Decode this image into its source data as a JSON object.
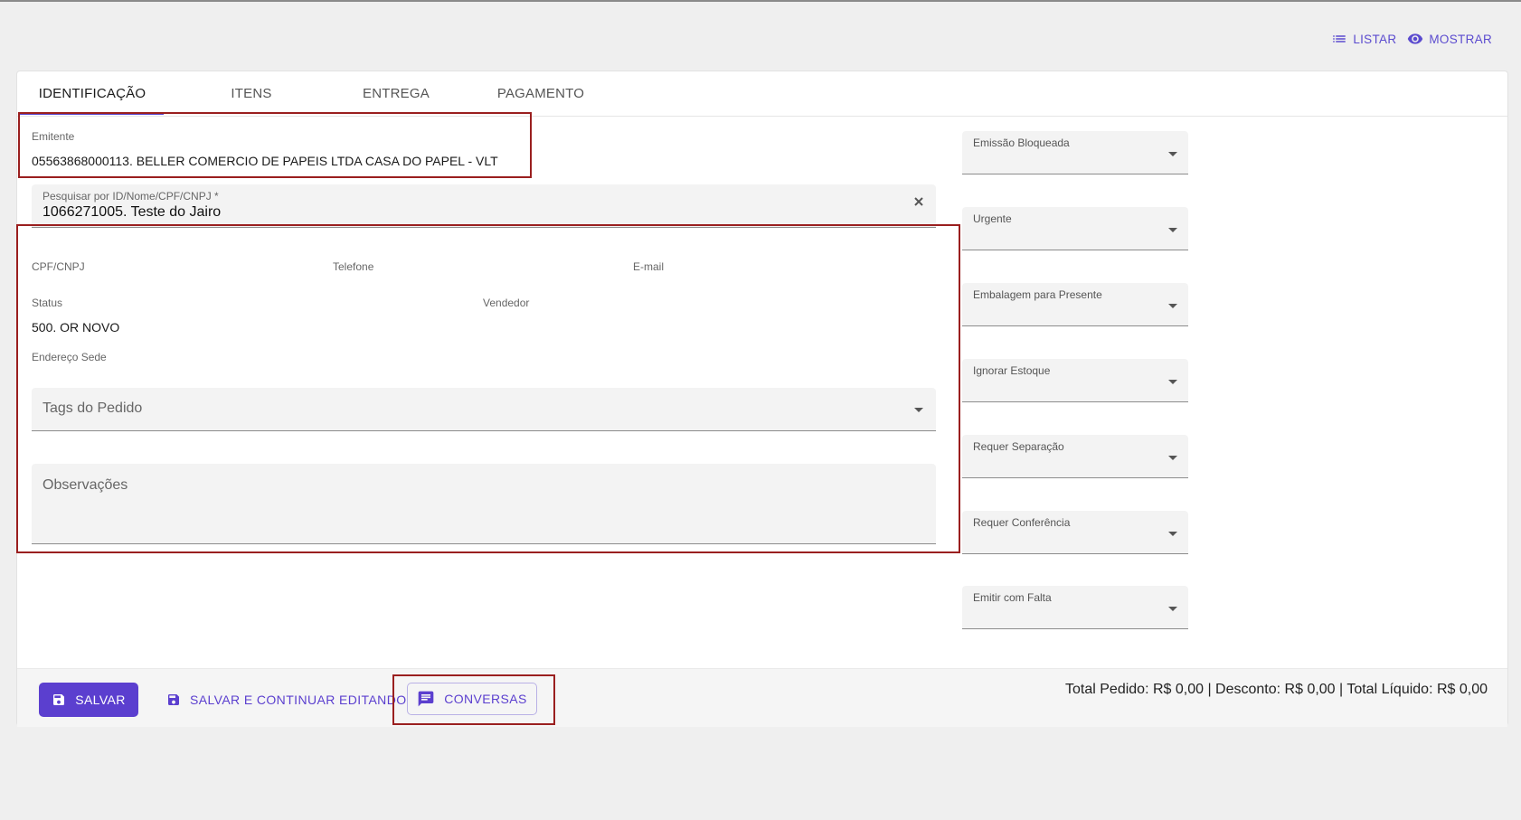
{
  "top_actions": {
    "list_label": "LISTAR",
    "show_label": "MOSTRAR"
  },
  "tabs": [
    {
      "label": "IDENTIFICAÇÃO"
    },
    {
      "label": "ITENS"
    },
    {
      "label": "ENTREGA"
    },
    {
      "label": "PAGAMENTO"
    }
  ],
  "emitente": {
    "label": "Emitente",
    "value": "05563868000113. BELLER COMERCIO DE PAPEIS LTDA CASA DO PAPEL - VLT"
  },
  "search": {
    "label": "Pesquisar por ID/Nome/CPF/CNPJ *",
    "value": "1066271005. Teste do Jairo"
  },
  "client_info": {
    "cpf_label": "CPF/CNPJ",
    "phone_label": "Telefone",
    "email_label": "E-mail",
    "status_label": "Status",
    "status_value": "500. OR NOVO",
    "seller_label": "Vendedor",
    "address_label": "Endereço Sede"
  },
  "tags": {
    "placeholder": "Tags do Pedido"
  },
  "observacoes": {
    "placeholder": "Observações"
  },
  "selects": [
    {
      "label": "Emissão Bloqueada"
    },
    {
      "label": "Urgente"
    },
    {
      "label": "Embalagem para Presente"
    },
    {
      "label": "Ignorar Estoque"
    },
    {
      "label": "Requer Separação"
    },
    {
      "label": "Requer Conferência"
    },
    {
      "label": "Emitir com Falta"
    }
  ],
  "footer": {
    "save_label": "SALVAR",
    "save_continue_label": "SALVAR E CONTINUAR EDITANDO",
    "conversations_label": "CONVERSAS",
    "totals_text": "Total Pedido: R$ 0,00 | Desconto: R$ 0,00 | Total Líquido: R$ 0,00"
  },
  "colors": {
    "accent": "#5b3fcf",
    "highlight_box": "#9a1f1f"
  }
}
